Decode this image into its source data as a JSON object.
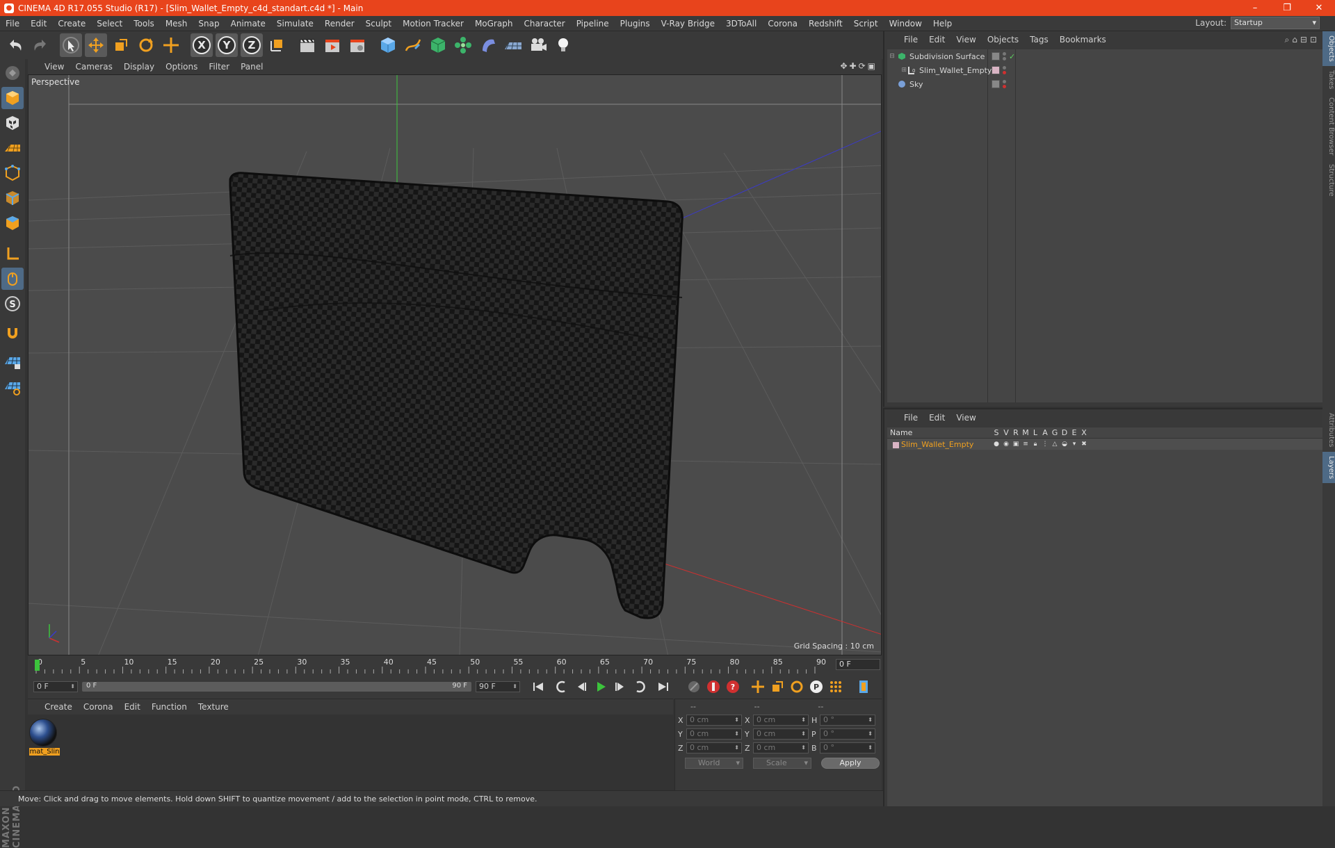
{
  "window": {
    "title": "CINEMA 4D R17.055 Studio (R17) - [Slim_Wallet_Empty_c4d_standart.c4d *] - Main",
    "controls": [
      "–",
      "❐",
      "✕"
    ]
  },
  "menubar": {
    "items": [
      "File",
      "Edit",
      "Create",
      "Select",
      "Tools",
      "Mesh",
      "Snap",
      "Animate",
      "Simulate",
      "Render",
      "Sculpt",
      "Motion Tracker",
      "MoGraph",
      "Character",
      "Pipeline",
      "Plugins",
      "V-Ray Bridge",
      "3DToAll",
      "Corona",
      "Redshift",
      "Script",
      "Window",
      "Help"
    ],
    "layout_label": "Layout:",
    "layout_value": "Startup"
  },
  "toolbar": {
    "axis_x": "X",
    "axis_y": "Y",
    "axis_z": "Z"
  },
  "viewport": {
    "menu": [
      "View",
      "Cameras",
      "Display",
      "Options",
      "Filter",
      "Panel"
    ],
    "label": "Perspective",
    "grid_spacing": "Grid Spacing : 10 cm"
  },
  "timeline": {
    "ticks": [
      "0",
      "5",
      "10",
      "15",
      "20",
      "25",
      "30",
      "35",
      "40",
      "45",
      "50",
      "55",
      "60",
      "65",
      "70",
      "75",
      "80",
      "85",
      "90"
    ],
    "current_frame": "0 F"
  },
  "playbar": {
    "start_frame": "0 F",
    "range_start": "0 F",
    "range_end": "90 F",
    "end_frame": "90 F"
  },
  "materials": {
    "menu": [
      "Create",
      "Corona",
      "Edit",
      "Function",
      "Texture"
    ],
    "items": [
      {
        "name": "mat_Slin"
      }
    ]
  },
  "coordinates": {
    "headers": [
      "--",
      "--",
      "--"
    ],
    "rows": [
      {
        "a_label": "X",
        "a_value": "0 cm",
        "b_label": "X",
        "b_value": "0 cm",
        "c_label": "H",
        "c_value": "0 °"
      },
      {
        "a_label": "Y",
        "a_value": "0 cm",
        "b_label": "Y",
        "b_value": "0 cm",
        "c_label": "P",
        "c_value": "0 °"
      },
      {
        "a_label": "Z",
        "a_value": "0 cm",
        "b_label": "Z",
        "b_value": "0 cm",
        "c_label": "B",
        "c_value": "0 °"
      }
    ],
    "mode": "World",
    "transform": "Scale",
    "apply_label": "Apply"
  },
  "status": {
    "text": "Move: Click and drag to move elements. Hold down SHIFT to quantize movement / add to the selection in point mode, CTRL to remove."
  },
  "object_manager": {
    "menu": [
      "File",
      "Edit",
      "View",
      "Objects",
      "Tags",
      "Bookmarks"
    ],
    "objects": [
      {
        "name": "Subdivision Surface",
        "icon": "subdivision-icon",
        "color": "#5fd060"
      },
      {
        "name": "Slim_Wallet_Empty",
        "icon": "layer-object-icon",
        "color": "#e0e0e0"
      },
      {
        "name": "Sky",
        "icon": "sky-icon",
        "color": "#7aa0d8"
      }
    ]
  },
  "layer_manager": {
    "menu": [
      "File",
      "Edit",
      "View"
    ],
    "columns": [
      "Name",
      "S",
      "V",
      "R",
      "M",
      "L",
      "A",
      "G",
      "D",
      "E",
      "X"
    ],
    "layers": [
      {
        "name": "Slim_Wallet_Empty",
        "color": "#d9b4c4"
      }
    ]
  },
  "side_tabs": [
    "Objects",
    "Takes",
    "Content Browser",
    "Structure",
    "Attributes",
    "Layers"
  ],
  "branding": {
    "logo_text": "MAXON CINEMA 4D"
  },
  "colors": {
    "titlebar": "#e8441c",
    "accent_orange": "#f0a020",
    "active_tool": "#4e6a86"
  }
}
